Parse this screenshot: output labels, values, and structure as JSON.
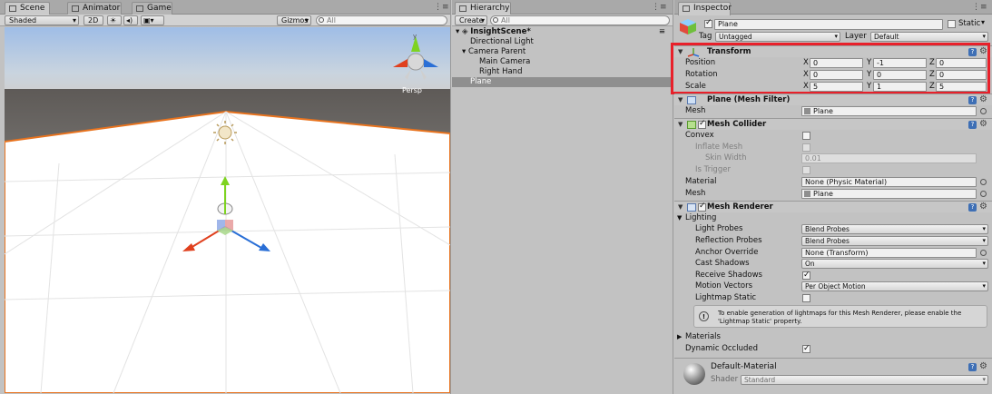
{
  "scene_panel": {
    "tabs": [
      {
        "label": "Scene",
        "icon": "scene-icon"
      },
      {
        "label": "Animator",
        "icon": "animator-icon"
      },
      {
        "label": "Game",
        "icon": "game-icon"
      }
    ],
    "toolbar": {
      "shading_mode": "Shaded",
      "mode_2d": "2D",
      "gizmos": "Gizmos",
      "search_placeholder": "All"
    },
    "view_label": "Persp"
  },
  "hierarchy": {
    "tab": "Hierarchy",
    "create": "Create",
    "search_placeholder": "All",
    "scene_name": "InsightScene*",
    "items": [
      {
        "label": "Directional Light"
      },
      {
        "label": "Camera Parent"
      },
      {
        "label": "Main Camera"
      },
      {
        "label": "Right Hand"
      },
      {
        "label": "Plane"
      }
    ]
  },
  "inspector": {
    "tab": "Inspector",
    "object_name": "Plane",
    "static_label": "Static",
    "tag_label": "Tag",
    "tag_value": "Untagged",
    "layer_label": "Layer",
    "layer_value": "Default",
    "transform": {
      "title": "Transform",
      "rows": [
        {
          "label": "Position",
          "x": "0",
          "y": "-1",
          "z": "0"
        },
        {
          "label": "Rotation",
          "x": "0",
          "y": "0",
          "z": "0"
        },
        {
          "label": "Scale",
          "x": "5",
          "y": "1",
          "z": "5"
        }
      ],
      "axis_x": "X",
      "axis_y": "Y",
      "axis_z": "Z",
      "highlight_color": "#e8202a"
    },
    "mesh_filter": {
      "title": "Plane (Mesh Filter)",
      "mesh_label": "Mesh",
      "mesh_value": "Plane"
    },
    "mesh_collider": {
      "title": "Mesh Collider",
      "convex": "Convex",
      "inflate_mesh": "Inflate Mesh",
      "skin_width": "Skin Width",
      "skin_width_value": "0.01",
      "is_trigger": "Is Trigger",
      "material_label": "Material",
      "material_value": "None (Physic Material)",
      "mesh_label": "Mesh",
      "mesh_value": "Plane"
    },
    "mesh_renderer": {
      "title": "Mesh Renderer",
      "lighting": "Lighting",
      "light_probes": "Light Probes",
      "light_probes_value": "Blend Probes",
      "reflection_probes": "Reflection Probes",
      "reflection_probes_value": "Blend Probes",
      "anchor_override": "Anchor Override",
      "anchor_override_value": "None (Transform)",
      "cast_shadows": "Cast Shadows",
      "cast_shadows_value": "On",
      "receive_shadows": "Receive Shadows",
      "motion_vectors": "Motion Vectors",
      "motion_vectors_value": "Per Object Motion",
      "lightmap_static": "Lightmap Static",
      "info_line1": "To enable generation of lightmaps for this Mesh Renderer, please enable the",
      "info_line2": "'Lightmap Static' property.",
      "materials": "Materials",
      "dynamic_occluded": "Dynamic Occluded"
    },
    "material": {
      "name": "Default-Material",
      "shader_label": "Shader",
      "shader_value": "Standard"
    }
  },
  "colors": {
    "selection_outline": "#e8731e",
    "axis_x": "#e0401e",
    "axis_y": "#7ed321",
    "axis_z": "#2a6fd6"
  }
}
